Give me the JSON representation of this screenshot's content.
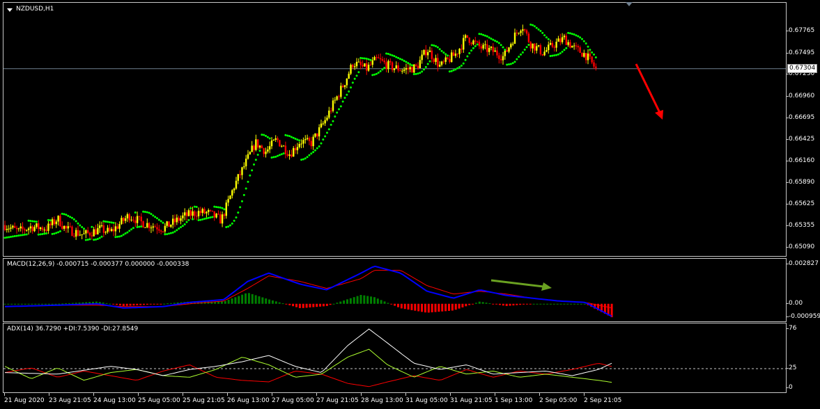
{
  "window": {
    "symbol_label": "NZDUSD,H1"
  },
  "colors": {
    "background": "#000000",
    "bull_candle": "#ffff00",
    "bear_candle": "#ff0000",
    "sar": "#00ff00",
    "macd_line": "#0000ff",
    "signal_line": "#ff0000",
    "hist_up": "#008000",
    "hist_down": "#ff0000",
    "adx_line": "#ffffff",
    "plus_di": "#adff2f",
    "minus_di": "#ff0000",
    "down_arrow": "#ff0000",
    "up_arrow": "#6aa121"
  },
  "price_scale": {
    "ticks": [
      "0.67765",
      "0.67495",
      "0.67230",
      "0.66960",
      "0.66695",
      "0.66425",
      "0.66160",
      "0.65890",
      "0.65625",
      "0.65355",
      "0.65090"
    ],
    "tick_values": [
      0.67765,
      0.67495,
      0.6723,
      0.6696,
      0.66695,
      0.66425,
      0.6616,
      0.6589,
      0.65625,
      0.65355,
      0.6509
    ],
    "current_price": "0.67304",
    "current_value": 0.67304
  },
  "macd": {
    "label": "MACD(12,26,9) -0.000715 -0.000377 0.000000 -0.000338",
    "ticks": [
      "0.002827",
      "0.00",
      "-0.000959"
    ],
    "tick_values": [
      0.002827,
      0.0,
      -0.000959
    ]
  },
  "adx": {
    "label": "ADX(14) 36.7290 +DI:7.5390 -DI:27.8549",
    "ticks": [
      "76",
      "25",
      "0"
    ],
    "tick_values": [
      76,
      25,
      0
    ],
    "level": 25
  },
  "time_axis": {
    "labels": [
      "21 Aug 2020",
      "23 Aug 21:05",
      "24 Aug 13:00",
      "25 Aug 05:00",
      "25 Aug 21:05",
      "26 Aug 13:00",
      "27 Aug 05:00",
      "27 Aug 21:05",
      "28 Aug 13:00",
      "31 Aug 05:00",
      "31 Aug 21:05",
      "1 Sep 13:00",
      "2 Sep 05:00",
      "2 Sep 21:05"
    ]
  },
  "chart_data": {
    "type": "candlestick",
    "symbol": "NZDUSD",
    "timeframe": "H1",
    "price_range": [
      0.6504,
      0.6805
    ],
    "close_path": [
      {
        "t": 0,
        "p": 0.6537
      },
      {
        "t": 0.5,
        "p": 0.6529
      },
      {
        "t": 1.0,
        "p": 0.6535
      },
      {
        "t": 1.6,
        "p": 0.6533
      },
      {
        "t": 2.0,
        "p": 0.6545
      },
      {
        "t": 2.3,
        "p": 0.6532
      },
      {
        "t": 3.0,
        "p": 0.6525
      },
      {
        "t": 3.6,
        "p": 0.6532
      },
      {
        "t": 4.0,
        "p": 0.6528
      },
      {
        "t": 4.7,
        "p": 0.6549
      },
      {
        "t": 5.2,
        "p": 0.654
      },
      {
        "t": 6.0,
        "p": 0.6533
      },
      {
        "t": 6.8,
        "p": 0.6548
      },
      {
        "t": 7.3,
        "p": 0.6553
      },
      {
        "t": 7.7,
        "p": 0.6552
      },
      {
        "t": 8.2,
        "p": 0.6543
      },
      {
        "t": 8.7,
        "p": 0.6586
      },
      {
        "t": 9.1,
        "p": 0.6612
      },
      {
        "t": 9.5,
        "p": 0.6639
      },
      {
        "t": 9.9,
        "p": 0.6628
      },
      {
        "t": 10.3,
        "p": 0.6643
      },
      {
        "t": 10.8,
        "p": 0.6625
      },
      {
        "t": 11.2,
        "p": 0.6641
      },
      {
        "t": 11.6,
        "p": 0.6638
      },
      {
        "t": 12.1,
        "p": 0.6664
      },
      {
        "t": 12.5,
        "p": 0.669
      },
      {
        "t": 12.9,
        "p": 0.6715
      },
      {
        "t": 13.2,
        "p": 0.6738
      },
      {
        "t": 13.7,
        "p": 0.673
      },
      {
        "t": 14.1,
        "p": 0.6742
      },
      {
        "t": 14.6,
        "p": 0.6733
      },
      {
        "t": 15.1,
        "p": 0.6729
      },
      {
        "t": 15.6,
        "p": 0.6732
      },
      {
        "t": 16.0,
        "p": 0.6755
      },
      {
        "t": 16.5,
        "p": 0.6733
      },
      {
        "t": 17.1,
        "p": 0.6749
      },
      {
        "t": 17.5,
        "p": 0.677
      },
      {
        "t": 18.0,
        "p": 0.6757
      },
      {
        "t": 18.5,
        "p": 0.6752
      },
      {
        "t": 18.9,
        "p": 0.6745
      },
      {
        "t": 19.3,
        "p": 0.677
      },
      {
        "t": 19.6,
        "p": 0.6785
      },
      {
        "t": 19.9,
        "p": 0.6762
      },
      {
        "t": 20.4,
        "p": 0.675
      },
      {
        "t": 20.8,
        "p": 0.676
      },
      {
        "t": 21.2,
        "p": 0.6768
      },
      {
        "t": 21.6,
        "p": 0.6755
      },
      {
        "t": 22.0,
        "p": 0.6748
      },
      {
        "t": 22.4,
        "p": 0.673
      }
    ],
    "parabolic_sar": "green dots above price during declines, below during advances",
    "macd_path": {
      "macd": [
        [
          0,
          -0.0002
        ],
        [
          2,
          -0.0001
        ],
        [
          3.5,
          0.0
        ],
        [
          4.5,
          -0.0003
        ],
        [
          6,
          -0.0002
        ],
        [
          7,
          0.0001
        ],
        [
          8.3,
          0.0003
        ],
        [
          9.2,
          0.0016
        ],
        [
          10,
          0.0022
        ],
        [
          11.2,
          0.0014
        ],
        [
          12.2,
          0.001
        ],
        [
          13.5,
          0.0022
        ],
        [
          14,
          0.0027
        ],
        [
          15,
          0.0022
        ],
        [
          16,
          0.0009
        ],
        [
          17,
          0.0004
        ],
        [
          18,
          0.001
        ],
        [
          19,
          0.0006
        ],
        [
          20,
          0.0004
        ],
        [
          21,
          0.0002
        ],
        [
          22,
          0.0001
        ],
        [
          23,
          -0.0009
        ]
      ],
      "signal": [
        [
          0,
          -0.0002
        ],
        [
          2,
          -0.0001
        ],
        [
          3.5,
          -0.0001
        ],
        [
          4.5,
          -0.0002
        ],
        [
          6,
          -0.0002
        ],
        [
          7,
          0.0
        ],
        [
          8.3,
          0.0002
        ],
        [
          9.2,
          0.0011
        ],
        [
          10,
          0.002
        ],
        [
          11.2,
          0.0016
        ],
        [
          12.2,
          0.0011
        ],
        [
          13.5,
          0.0018
        ],
        [
          14,
          0.0024
        ],
        [
          15,
          0.0024
        ],
        [
          16,
          0.0013
        ],
        [
          17,
          0.0007
        ],
        [
          18,
          0.0009
        ],
        [
          19,
          0.0007
        ],
        [
          20,
          0.0004
        ],
        [
          21,
          0.0002
        ],
        [
          22,
          0.0001
        ],
        [
          23,
          -0.0003
        ]
      ]
    },
    "adx_path": {
      "adx": [
        [
          0,
          20
        ],
        [
          2,
          18
        ],
        [
          4,
          28
        ],
        [
          5,
          24
        ],
        [
          6,
          16
        ],
        [
          7,
          24
        ],
        [
          8,
          28
        ],
        [
          9,
          34
        ],
        [
          10,
          42
        ],
        [
          11,
          28
        ],
        [
          12,
          20
        ],
        [
          13,
          55
        ],
        [
          13.8,
          76
        ],
        [
          14.5,
          58
        ],
        [
          15.5,
          32
        ],
        [
          16.5,
          24
        ],
        [
          17.5,
          30
        ],
        [
          18.5,
          18
        ],
        [
          19.5,
          20
        ],
        [
          20.5,
          22
        ],
        [
          21.5,
          16
        ],
        [
          22.5,
          24
        ],
        [
          23,
          32
        ]
      ],
      "plus_di": [
        [
          0,
          28
        ],
        [
          1,
          12
        ],
        [
          2,
          26
        ],
        [
          3,
          10
        ],
        [
          4,
          20
        ],
        [
          5,
          24
        ],
        [
          6,
          16
        ],
        [
          7,
          14
        ],
        [
          8,
          24
        ],
        [
          9,
          40
        ],
        [
          10,
          30
        ],
        [
          11,
          14
        ],
        [
          12,
          18
        ],
        [
          13,
          40
        ],
        [
          13.8,
          50
        ],
        [
          14.5,
          30
        ],
        [
          15.5,
          14
        ],
        [
          16.5,
          28
        ],
        [
          17.5,
          18
        ],
        [
          18.5,
          22
        ],
        [
          19.5,
          14
        ],
        [
          20.5,
          18
        ],
        [
          21.5,
          14
        ],
        [
          22.5,
          10
        ],
        [
          23,
          7.5
        ]
      ],
      "minus_di": [
        [
          0,
          20
        ],
        [
          1,
          26
        ],
        [
          2,
          14
        ],
        [
          3,
          22
        ],
        [
          4,
          16
        ],
        [
          5,
          10
        ],
        [
          6,
          22
        ],
        [
          7,
          30
        ],
        [
          8,
          14
        ],
        [
          9,
          10
        ],
        [
          10,
          8
        ],
        [
          11,
          22
        ],
        [
          12,
          18
        ],
        [
          13,
          6
        ],
        [
          13.8,
          2
        ],
        [
          14.5,
          8
        ],
        [
          15.5,
          16
        ],
        [
          16.5,
          10
        ],
        [
          17.5,
          24
        ],
        [
          18.5,
          14
        ],
        [
          19.5,
          22
        ],
        [
          20.5,
          18
        ],
        [
          21.5,
          24
        ],
        [
          22.5,
          32
        ],
        [
          23,
          27.85
        ]
      ]
    }
  }
}
